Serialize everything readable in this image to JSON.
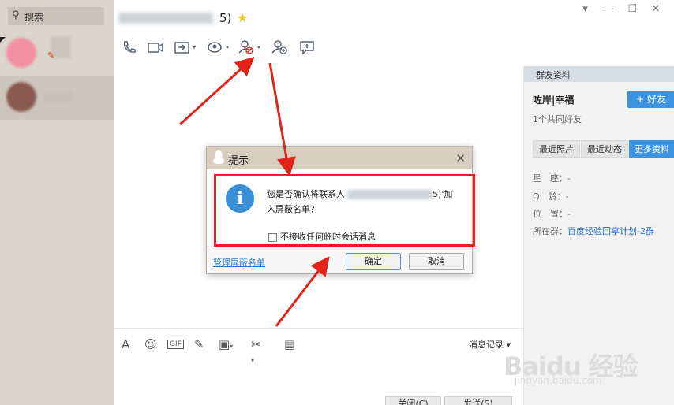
{
  "search": {
    "icon": "search-icon",
    "label": "搜索"
  },
  "chat": {
    "title_suffix": "5)"
  },
  "window_controls": {
    "dropdown": "▾",
    "minimize": "—",
    "maximize": "☐",
    "close": "✕"
  },
  "info_panel": {
    "header": "群友资料",
    "name": "咗岸|幸福",
    "add_friend": "+ 好友",
    "mutual": "1个共同好友",
    "tabs": [
      "最近照片",
      "最近动态",
      "更多资料"
    ],
    "star_sign_label": "星　座：",
    "star_sign_value": "-",
    "age_label": "Q　龄：",
    "age_value": "-",
    "location_label": "位　置：",
    "location_value": "-",
    "group_label": "所在群：",
    "group_value": "百度经验回享计划-2群"
  },
  "compose": {
    "history": "消息记录 ▾",
    "close_btn": "关闭(C)",
    "send_btn": "发送(S)"
  },
  "dialog": {
    "title": "提示",
    "close": "✕",
    "icon": "i",
    "message_pre": "您是否确认将联系人'",
    "message_post": "5)'加入屏蔽名单？",
    "checkbox_label": "不接收任何临时会话消息",
    "manage_link": "管理屏蔽名单",
    "ok": "确定",
    "cancel": "取消"
  },
  "watermark": {
    "text": "Baidu 经验",
    "url": "jingyan.baidu.com"
  },
  "colors": {
    "annotation_red": "#e2231a",
    "accent_blue": "#3c93e0"
  }
}
